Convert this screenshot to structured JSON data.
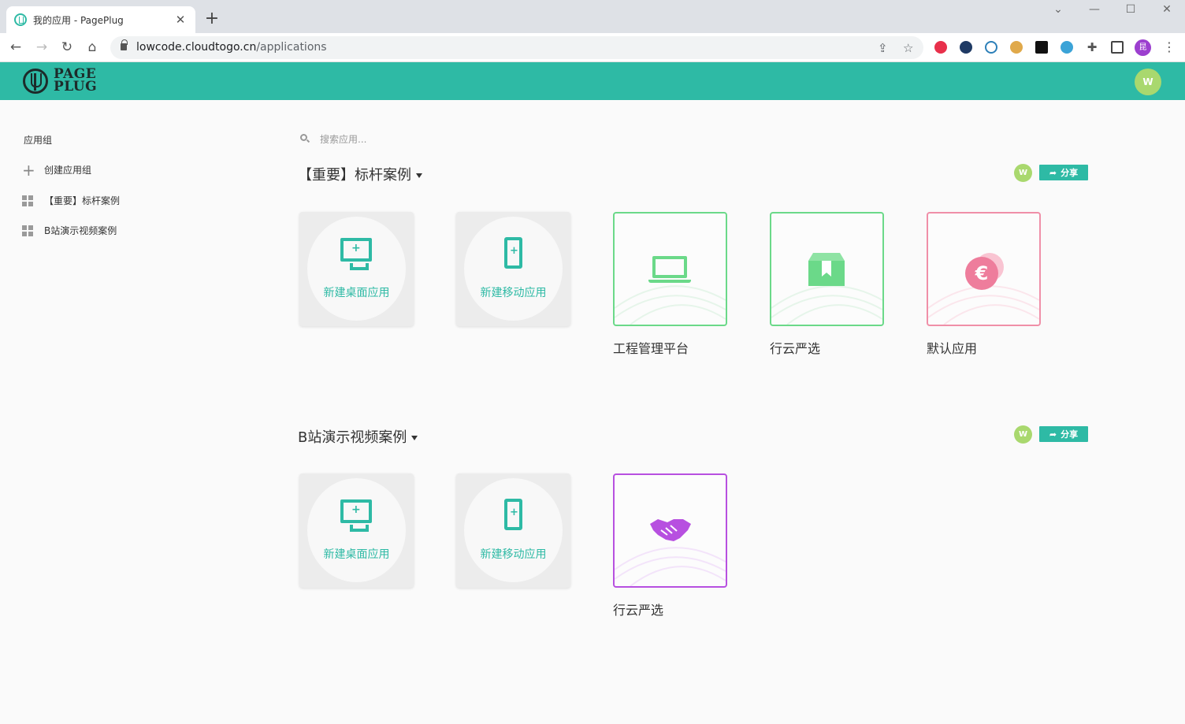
{
  "browser": {
    "tab_title": "我的应用 - PagePlug",
    "url_host": "lowcode.cloudtogo.cn",
    "url_path": "/applications",
    "profile_initial": "昆"
  },
  "header": {
    "logo_line1": "PAGE",
    "logo_line2": "PLUG",
    "user_initial": "W",
    "brand_color": "#2ebaa5"
  },
  "sidebar": {
    "title": "应用组",
    "items": [
      {
        "label": "创建应用组",
        "icon": "plus-icon"
      },
      {
        "label": "【重要】标杆案例",
        "icon": "grid-icon"
      },
      {
        "label": "B站演示视频案例",
        "icon": "grid-icon"
      }
    ]
  },
  "search": {
    "placeholder": "搜索应用..."
  },
  "groups": [
    {
      "title": "【重要】标杆案例",
      "member_initial": "W",
      "share_label": "分享",
      "new_desktop_label": "新建桌面应用",
      "new_mobile_label": "新建移动应用",
      "apps": [
        {
          "name": "工程管理平台",
          "icon": "laptop-icon",
          "color": "#6bd989"
        },
        {
          "name": "行云严选",
          "icon": "box-icon",
          "color": "#6bd989"
        },
        {
          "name": "默认应用",
          "icon": "euro-coin-icon",
          "color": "#f08fa8"
        }
      ]
    },
    {
      "title": "B站演示视频案例",
      "member_initial": "W",
      "share_label": "分享",
      "new_desktop_label": "新建桌面应用",
      "new_mobile_label": "新建移动应用",
      "apps": [
        {
          "name": "行云严选",
          "icon": "handshake-icon",
          "color": "#b750e0"
        }
      ]
    }
  ]
}
